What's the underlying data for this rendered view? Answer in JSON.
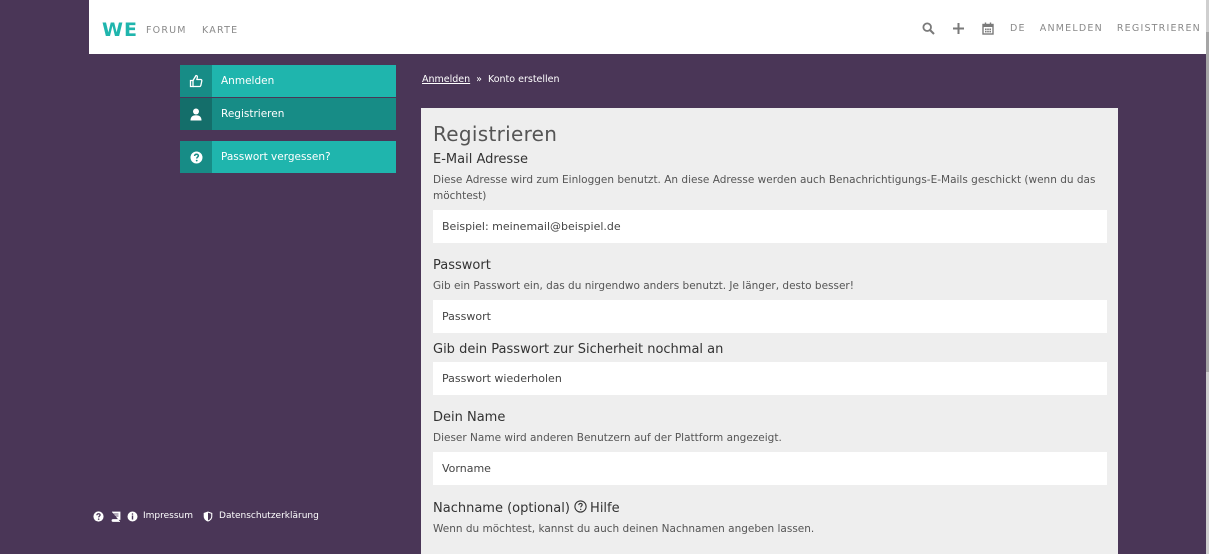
{
  "nav": {
    "logo": "WE",
    "links": [
      "FORUM",
      "KARTE"
    ],
    "language": "DE",
    "login": "ANMELDEN",
    "register": "REGISTRIEREN"
  },
  "sidebar": {
    "items": [
      {
        "label": "Anmelden",
        "icon": "thumbs-up-icon"
      },
      {
        "label": "Registrieren",
        "icon": "user-icon"
      },
      {
        "label": "Passwort vergessen?",
        "icon": "question-circle-icon"
      }
    ],
    "footer": {
      "impressum": "Impressum",
      "privacy": "Datenschutzerklärung"
    }
  },
  "breadcrumb": {
    "link": "Anmelden",
    "separator": "»",
    "current": "Konto erstellen"
  },
  "form": {
    "title": "Registrieren",
    "email": {
      "label": "E-Mail Adresse",
      "help": "Diese Adresse wird zum Einloggen benutzt. An diese Adresse werden auch Benachrichtigungs-E-Mails geschickt (wenn du das möchtest)",
      "placeholder": "Beispiel: meinemail@beispiel.de"
    },
    "password": {
      "label": "Passwort",
      "help": "Gib ein Passwort ein, das du nirgendwo anders benutzt. Je länger, desto besser!",
      "placeholder": "Passwort"
    },
    "password_repeat": {
      "label": "Gib dein Passwort zur Sicherheit nochmal an",
      "placeholder": "Passwort wiederholen"
    },
    "name": {
      "label": "Dein Name",
      "help": "Dieser Name wird anderen Benutzern auf der Plattform angezeigt.",
      "placeholder": "Vorname"
    },
    "lastname": {
      "label": "Nachname (optional)",
      "hilfe": "Hilfe",
      "help": "Wenn du möchtest, kannst du auch deinen Nachnamen angeben lassen."
    }
  },
  "colors": {
    "background": "#4a3657",
    "accent": "#1fb5ad",
    "accent_dark": "#178c86",
    "card": "#eeeeee"
  }
}
